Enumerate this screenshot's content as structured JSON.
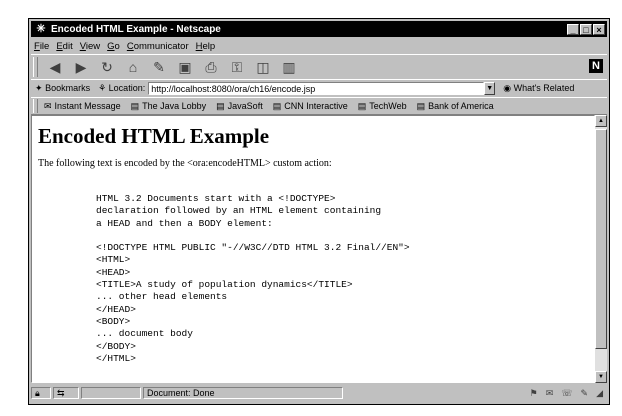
{
  "window": {
    "title": "Encoded HTML Example - Netscape"
  },
  "menu": [
    "File",
    "Edit",
    "View",
    "Go",
    "Communicator",
    "Help"
  ],
  "location": {
    "bookmarks_label": "Bookmarks",
    "location_label": "Location:",
    "url": "http://localhost:8080/ora/ch16/encode.jsp",
    "related_label": "What's Related"
  },
  "personal_toolbar": [
    "Instant Message",
    "The Java Lobby",
    "JavaSoft",
    "CNN Interactive",
    "TechWeb",
    "Bank of America"
  ],
  "page": {
    "heading": "Encoded HTML Example",
    "intro": "The following text is encoded by the <ora:encodeHTML> custom action:",
    "pre_text": "HTML 3.2 Documents start with a <!DOCTYPE>\ndeclaration followed by an HTML element containing\na HEAD and then a BODY element:\n\n<!DOCTYPE HTML PUBLIC \"-//W3C//DTD HTML 3.2 Final//EN\">\n<HTML>\n<HEAD>\n<TITLE>A study of population dynamics</TITLE>\n... other head elements\n</HEAD>\n<BODY>\n... document body\n</BODY>\n</HTML>"
  },
  "status": {
    "text": "Document: Done"
  }
}
